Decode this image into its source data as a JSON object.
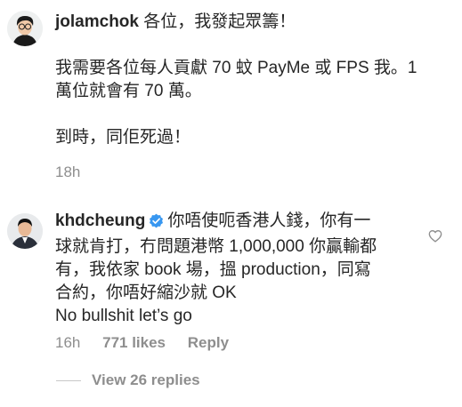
{
  "comments": [
    {
      "username": "jolamchok",
      "first_line": " 各位，我發起眾籌！",
      "paragraph_2": [
        "我需要各位每人貢獻 70 蚊 PayMe 或 FPS 我。1",
        "萬位就會有 70 萬。"
      ],
      "paragraph_3": "到時，同佢死過！",
      "time": "18h"
    },
    {
      "username": "khdcheung",
      "verified": true,
      "lines": [
        "你唔使呃香港人錢，你有一",
        "球就肯打，冇問題港幣 1,000,000 你贏輸都",
        "有，我依家 book 場，搵 production，同寫",
        "合約，你唔好縮沙就 OK",
        "No bullshit let’s go"
      ],
      "time": "16h",
      "likes": "771 likes",
      "reply_label": "Reply",
      "view_replies": "View 26 replies"
    }
  ],
  "icons": {
    "verified": "verified-badge-icon",
    "heart": "heart-icon"
  },
  "colors": {
    "text": "#262626",
    "secondary": "#8e8e8e",
    "verified": "#3897f0"
  }
}
